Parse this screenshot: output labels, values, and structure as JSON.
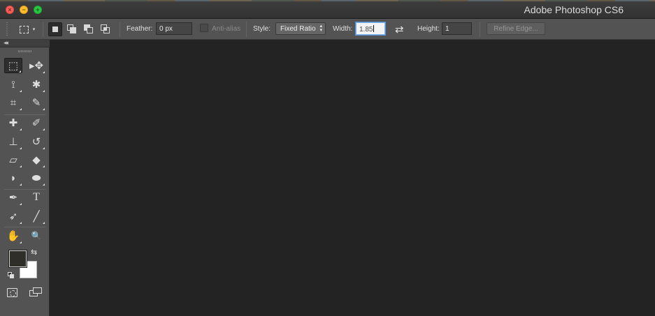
{
  "window": {
    "title": "Adobe Photoshop CS6",
    "controls": {
      "close": "×",
      "minimize": "−",
      "maximize": "+"
    }
  },
  "options_bar": {
    "tool_preset_icon": "rectangular-marquee-icon",
    "preset_caret": "▾",
    "selection_modes": [
      {
        "name": "new-selection",
        "active": true
      },
      {
        "name": "add-to-selection",
        "active": false
      },
      {
        "name": "subtract-from-selection",
        "active": false
      },
      {
        "name": "intersect-with-selection",
        "active": false
      }
    ],
    "feather_label": "Feather:",
    "feather_value": "0 px",
    "antialias_label": "Anti-alias",
    "antialias_checked": false,
    "style_label": "Style:",
    "style_value": "Fixed Ratio",
    "style_arrows": "▲▼",
    "width_label": "Width:",
    "width_value": "1.85",
    "swap_icon": "⇄",
    "height_label": "Height:",
    "height_value": "1",
    "refine_edge_label": "Refine Edge..."
  },
  "tools_panel": {
    "collapse_glyph": "◂◂",
    "tools": [
      {
        "name": "rectangular-marquee-tool",
        "glyph": "⬚",
        "selected": true
      },
      {
        "name": "move-tool",
        "glyph": "▸✥",
        "selected": false
      },
      {
        "name": "lasso-tool",
        "glyph": "⟟",
        "selected": false
      },
      {
        "name": "magic-wand-tool",
        "glyph": "✱",
        "selected": false
      },
      {
        "name": "crop-tool",
        "glyph": "⌗",
        "selected": false
      },
      {
        "name": "eyedropper-tool",
        "glyph": "✎",
        "selected": false
      },
      {
        "name": "healing-brush-tool",
        "glyph": "✚",
        "selected": false
      },
      {
        "name": "brush-tool",
        "glyph": "✐",
        "selected": false
      },
      {
        "name": "clone-stamp-tool",
        "glyph": "⊥",
        "selected": false
      },
      {
        "name": "history-brush-tool",
        "glyph": "↺",
        "selected": false
      },
      {
        "name": "eraser-tool",
        "glyph": "▱",
        "selected": false
      },
      {
        "name": "paint-bucket-tool",
        "glyph": "◆",
        "selected": false
      },
      {
        "name": "blur-tool",
        "glyph": "◗",
        "selected": false
      },
      {
        "name": "dodge-tool",
        "glyph": "⬬",
        "selected": false
      },
      {
        "name": "pen-tool",
        "glyph": "✒",
        "selected": false
      },
      {
        "name": "type-tool",
        "glyph": "T",
        "selected": false
      },
      {
        "name": "path-selection-tool",
        "glyph": "➶",
        "selected": false
      },
      {
        "name": "line-tool",
        "glyph": "╱",
        "selected": false
      },
      {
        "name": "hand-tool",
        "glyph": "✋",
        "selected": false
      },
      {
        "name": "zoom-tool",
        "glyph": "🔍",
        "selected": false
      }
    ],
    "swap_colors_glyph": "⇆",
    "foreground_color": "#302e29",
    "background_color": "#ffffff"
  },
  "theme": {
    "panel": "#535353",
    "canvas": "#232323",
    "titlebar": "#383838"
  }
}
